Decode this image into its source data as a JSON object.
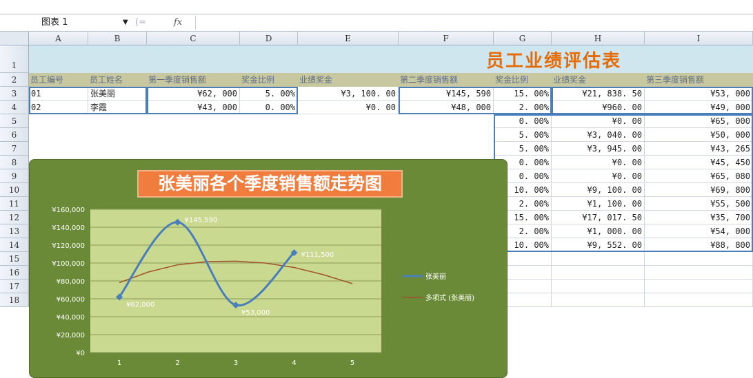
{
  "formula_bar": {
    "name_box": "图表 1",
    "fx_label": "fx",
    "fx_sep": "(="
  },
  "columns": [
    "A",
    "B",
    "C",
    "D",
    "E",
    "F",
    "G",
    "H",
    "I"
  ],
  "rows": [
    "1",
    "2",
    "3",
    "4",
    "5",
    "6",
    "7",
    "8",
    "9",
    "10",
    "11",
    "12",
    "13",
    "14",
    "15",
    "16",
    "17",
    "18"
  ],
  "sheet_title": "员工业绩评估表",
  "headers": [
    "员工编号",
    "员工姓名",
    "第一季度销售额",
    "奖金比例",
    "业绩奖金",
    "第二季度销售额",
    "奖金比例",
    "业绩奖金",
    "第三季度销售额"
  ],
  "data_rows": [
    [
      "01",
      "张美丽",
      "¥62, 000",
      "5. 00%",
      "¥3, 100. 00",
      "¥145, 590",
      "15. 00%",
      "¥21, 838. 50",
      "¥53, 000"
    ],
    [
      "02",
      "李霞",
      "¥43, 000",
      "0. 00%",
      "¥0. 00",
      "¥48, 000",
      "2. 00%",
      "¥960. 00",
      "¥49, 000"
    ]
  ],
  "right_rows": [
    [
      "0. 00%",
      "¥0. 00",
      "¥65, 000"
    ],
    [
      "5. 00%",
      "¥3, 040. 00",
      "¥50, 000"
    ],
    [
      "5. 00%",
      "¥3, 945. 00",
      "¥43, 265"
    ],
    [
      "0. 00%",
      "¥0. 00",
      "¥45, 450"
    ],
    [
      "0. 00%",
      "¥0. 00",
      "¥65, 080"
    ],
    [
      "10. 00%",
      "¥9, 100. 00",
      "¥69, 800"
    ],
    [
      "2. 00%",
      "¥1, 100. 00",
      "¥55, 500"
    ],
    [
      "15. 00%",
      "¥17, 017. 50",
      "¥35, 700"
    ],
    [
      "2. 00%",
      "¥1, 000. 00",
      "¥54, 000"
    ],
    [
      "10. 00%",
      "¥9, 552. 00",
      "¥88, 800"
    ]
  ],
  "colors": {
    "chart_bg": "#6b8a38",
    "plot_bg": "#c9d98f",
    "series": "#4a7ebb",
    "trend": "#a0522d",
    "title_bg": "#f07c3e",
    "sheet_title": "#e46c0a"
  },
  "chart_data": {
    "type": "line",
    "title": "张美丽各个季度销售额走势图",
    "x": [
      1,
      2,
      3,
      4,
      5
    ],
    "x_ticks": [
      "1",
      "2",
      "3",
      "4",
      "5"
    ],
    "y_ticks": [
      "¥0",
      "¥20,000",
      "¥40,000",
      "¥60,000",
      "¥80,000",
      "¥100,000",
      "¥120,000",
      "¥140,000",
      "¥160,000"
    ],
    "ylim": [
      0,
      160000
    ],
    "series": [
      {
        "name": "张美丽",
        "x": [
          1,
          2,
          3,
          4
        ],
        "values": [
          62000,
          145590,
          53000,
          111500
        ],
        "labels": [
          "¥62,000",
          "¥145,590",
          "¥53,000",
          "¥111,500"
        ]
      },
      {
        "name": "多项式 (张美丽)",
        "x": [
          1,
          1.5,
          2,
          2.5,
          3,
          3.5,
          4,
          4.5,
          5
        ],
        "values": [
          78000,
          90000,
          98000,
          101500,
          102000,
          100000,
          95000,
          87000,
          77000
        ]
      }
    ],
    "grid": true,
    "legend": "right"
  }
}
